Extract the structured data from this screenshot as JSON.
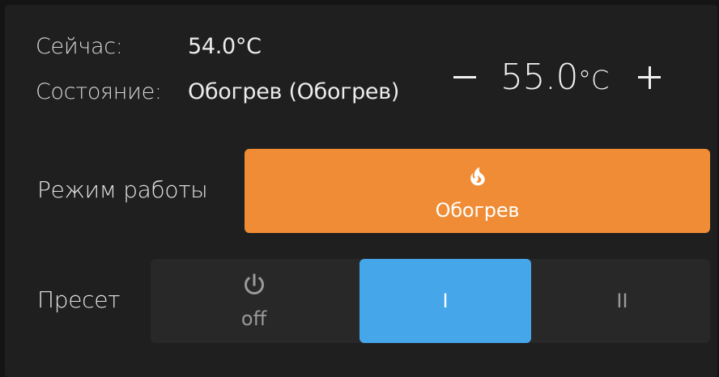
{
  "status": {
    "current_label": "Сейчас:",
    "current_value": "54.0°C",
    "state_label": "Состояние:",
    "state_value": "Обогрев (Обогрев)"
  },
  "target": {
    "decrease_symbol": "−",
    "value": "55.0",
    "unit": "°C",
    "increase_symbol": "+"
  },
  "mode": {
    "label": "Режим работы",
    "button_text": "Обогрев",
    "icon": "fire-icon",
    "color": "#ef8c35"
  },
  "preset": {
    "label": "Пресет",
    "options": [
      {
        "text": "off",
        "icon": "power-icon",
        "selected": false
      },
      {
        "text": "I",
        "selected": true
      },
      {
        "text": "II",
        "selected": false
      }
    ],
    "selected_color": "#45a6ea",
    "group_color": "#282828"
  },
  "colors": {
    "background": "#141414",
    "card": "#1f1f1f",
    "text": "#e1e1e1"
  }
}
